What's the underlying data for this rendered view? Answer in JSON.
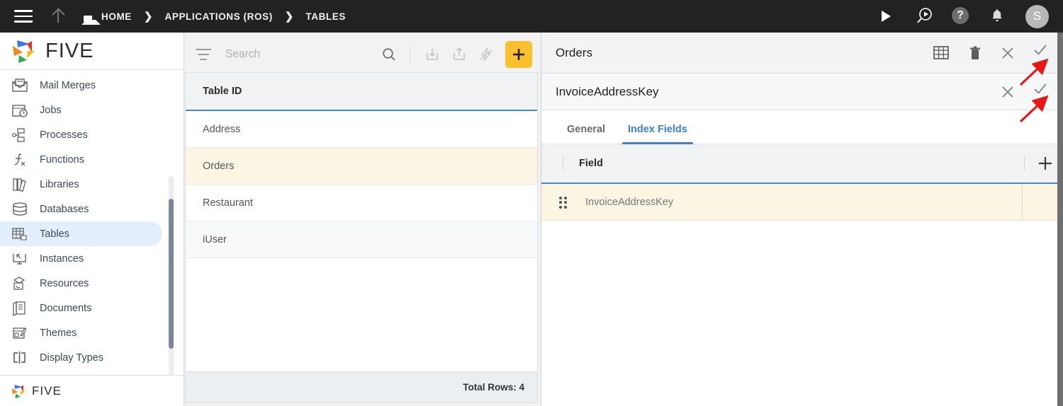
{
  "topbar": {
    "menu_icon": "hamburger-icon",
    "up_icon": "arrow-up-icon",
    "breadcrumb": [
      {
        "label": "HOME",
        "icon": "home-icon"
      },
      {
        "label": "APPLICATIONS (ROS)",
        "icon": ""
      },
      {
        "label": "TABLES",
        "icon": ""
      }
    ],
    "separator": "❯",
    "actions": [
      {
        "name": "run-icon",
        "glyph": "play"
      },
      {
        "name": "search-play-icon",
        "glyph": "search-play"
      },
      {
        "name": "help-icon",
        "glyph": "?"
      },
      {
        "name": "notifications-bell-icon",
        "glyph": "bell"
      }
    ],
    "avatar_initial": "S"
  },
  "sidebar": {
    "logo_text": "FIVE",
    "footer_logo_text": "FIVE",
    "items": [
      {
        "label": "Mail Merges",
        "icon": "mail-merge-icon",
        "active": false
      },
      {
        "label": "Jobs",
        "icon": "jobs-calendar-icon",
        "active": false
      },
      {
        "label": "Processes",
        "icon": "processes-flow-icon",
        "active": false
      },
      {
        "label": "Functions",
        "icon": "functions-fx-icon",
        "active": false
      },
      {
        "label": "Libraries",
        "icon": "libraries-books-icon",
        "active": false
      },
      {
        "label": "Databases",
        "icon": "databases-cylinder-icon",
        "active": false
      },
      {
        "label": "Tables",
        "icon": "tables-grid-icon",
        "active": true
      },
      {
        "label": "Instances",
        "icon": "instances-monitor-icon",
        "active": false
      },
      {
        "label": "Resources",
        "icon": "resources-box-icon",
        "active": false
      },
      {
        "label": "Documents",
        "icon": "documents-pages-icon",
        "active": false
      },
      {
        "label": "Themes",
        "icon": "themes-palette-icon",
        "active": false
      },
      {
        "label": "Display Types",
        "icon": "display-types-icon",
        "active": false
      }
    ]
  },
  "middle": {
    "search": {
      "value": "",
      "placeholder": "Search"
    },
    "toolbar": [
      {
        "name": "filter-icon"
      },
      {
        "name": "search-icon"
      },
      {
        "name": "import-icon"
      },
      {
        "name": "export-icon"
      },
      {
        "name": "lightning-icon"
      },
      {
        "name": "add-record-button",
        "label": "+",
        "color": "#fbc02d"
      }
    ],
    "grid": {
      "column_header": "Table ID",
      "rows": [
        {
          "name": "Address",
          "selected": false
        },
        {
          "name": "Orders",
          "selected": true
        },
        {
          "name": "Restaurant",
          "selected": false
        },
        {
          "name": "iUser",
          "selected": false
        }
      ]
    },
    "footer_text": "Total Rows: 4"
  },
  "right": {
    "header": {
      "title": "Orders",
      "actions": [
        {
          "name": "table-grid-icon"
        },
        {
          "name": "delete-trash-icon"
        },
        {
          "name": "close-icon"
        },
        {
          "name": "confirm-check-icon"
        }
      ]
    },
    "subheader": {
      "title": "InvoiceAddressKey",
      "actions": [
        {
          "name": "close-icon"
        },
        {
          "name": "confirm-check-icon"
        }
      ]
    },
    "tabs": [
      {
        "label": "General",
        "active": false
      },
      {
        "label": "Index Fields",
        "active": true
      }
    ],
    "field_grid": {
      "column_header": "Field",
      "add_label": "+",
      "rows": [
        {
          "field": "InvoiceAddressKey",
          "selected": true
        }
      ]
    }
  },
  "annotations": [
    {
      "name": "red-arrow-annotation-top"
    },
    {
      "name": "red-arrow-annotation-bottom"
    }
  ],
  "colors": {
    "topbar_bg": "#222222",
    "accent_blue": "#3f8ad8",
    "selected_row": "#fdf5e4",
    "add_button": "#fbc02d",
    "annotation_red": "#e81717",
    "nav_active": "#e3effc"
  }
}
